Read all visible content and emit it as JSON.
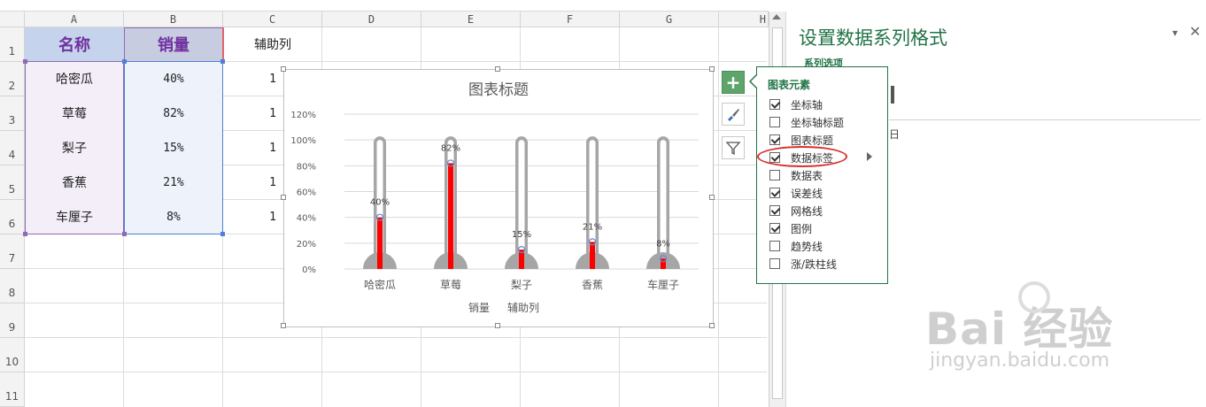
{
  "sheet": {
    "columns": [
      "A",
      "B",
      "C",
      "D",
      "E",
      "F",
      "G",
      "H"
    ],
    "rows": [
      "1",
      "2",
      "3",
      "4",
      "5",
      "6",
      "7",
      "8",
      "9",
      "10",
      "11"
    ],
    "headers": {
      "name": "名称",
      "sales": "销量",
      "helper": "辅助列"
    },
    "data": [
      {
        "name": "哈密瓜",
        "sales": "40%",
        "helper": "1"
      },
      {
        "name": "草莓",
        "sales": "82%",
        "helper": "1"
      },
      {
        "name": "梨子",
        "sales": "15%",
        "helper": "1"
      },
      {
        "name": "香蕉",
        "sales": "21%",
        "helper": "1"
      },
      {
        "name": "车厘子",
        "sales": "8%",
        "helper": "1"
      }
    ]
  },
  "chart_data": {
    "type": "bar",
    "title": "图表标题",
    "categories": [
      "哈密瓜",
      "草莓",
      "梨子",
      "香蕉",
      "车厘子"
    ],
    "series": [
      {
        "name": "销量",
        "values": [
          0.4,
          0.82,
          0.15,
          0.21,
          0.08
        ],
        "labels": [
          "40%",
          "82%",
          "15%",
          "21%",
          "8%"
        ],
        "color": "#ff0000"
      },
      {
        "name": "辅助列",
        "values": [
          1,
          1,
          1,
          1,
          1
        ],
        "color": "#a6a6a6"
      }
    ],
    "yticks": [
      "0%",
      "20%",
      "40%",
      "60%",
      "80%",
      "100%",
      "120%"
    ],
    "ylim": [
      0,
      1.2
    ],
    "legend": [
      "销量",
      "辅助列"
    ],
    "legend_position": "bottom",
    "grid": true
  },
  "chart_buttons": {
    "elements": "chart-elements",
    "styles": "chart-styles",
    "filters": "chart-filters"
  },
  "popup": {
    "title": "图表元素",
    "items": [
      {
        "label": "坐标轴",
        "checked": true
      },
      {
        "label": "坐标轴标题",
        "checked": false
      },
      {
        "label": "图表标题",
        "checked": true
      },
      {
        "label": "数据标签",
        "checked": true
      },
      {
        "label": "数据表",
        "checked": false
      },
      {
        "label": "误差线",
        "checked": true
      },
      {
        "label": "网格线",
        "checked": true
      },
      {
        "label": "图例",
        "checked": true
      },
      {
        "label": "趋势线",
        "checked": false
      },
      {
        "label": "涨/跌柱线",
        "checked": false
      }
    ]
  },
  "pane": {
    "title": "设置数据系列格式",
    "section": "系列选项",
    "partial_text": "日"
  },
  "watermark": {
    "brand": "Bai  经验",
    "url": "jingyan.baidu.com"
  }
}
